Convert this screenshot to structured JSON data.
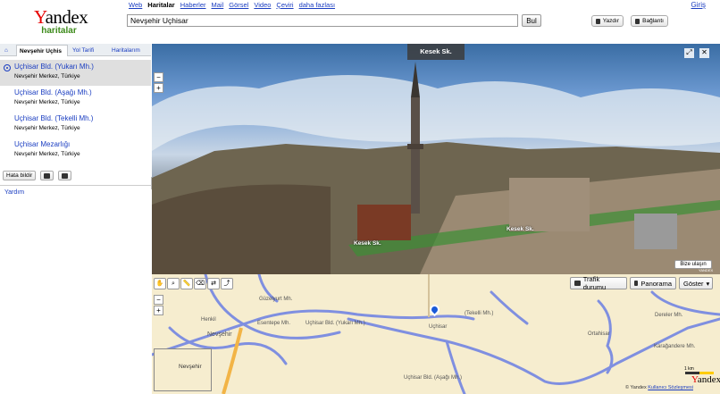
{
  "header": {
    "logo_text_first": "Y",
    "logo_text_rest": "andex",
    "logo_sub": "haritalar",
    "services": [
      "Web",
      "Haritalar",
      "Haberler",
      "Mail",
      "Görsel",
      "Video",
      "Çeviri",
      "daha fazlası"
    ],
    "active_service": "Haritalar",
    "login_label": "Giriş",
    "search_value": "Nevşehir Uçhisar",
    "search_button": "Bul",
    "print_label": "Yazdır",
    "link_label": "Bağlantı"
  },
  "sidebar": {
    "tabs": {
      "search": "Nevşehir Uçhis",
      "route": "Yol Tarifi",
      "maps": "Haritalarım"
    },
    "results": [
      {
        "title": "Uçhisar Bld. (Yukarı Mh.)",
        "address": "Nevşehir Merkez, Türkiye"
      },
      {
        "title": "Uçhisar Bld. (Aşağı Mh.)",
        "address": "Nevşehir Merkez, Türkiye"
      },
      {
        "title": "Uçhisar Bld. (Tekelli Mh.)",
        "address": "Nevşehir Merkez, Türkiye"
      },
      {
        "title": "Uçhisar Mezarlığı",
        "address": "Nevşehir Merkez, Türkiye"
      }
    ],
    "report_error": "Hata bildir",
    "help": "Yardım"
  },
  "panorama": {
    "street_label": "Kesek Sk.",
    "street_tag_1": "Kesek Sk.",
    "street_tag_2": "Kesek Sk.",
    "report_button": "Bize ulaşın",
    "brand": "YANDEX"
  },
  "map": {
    "traffic_label": "Trafik durumu",
    "panorama_label": "Panorama",
    "show_label": "Göster",
    "labels": {
      "guzelyurt": "Güzelyurt Mh.",
      "esentepe": "Esentepe Mh.",
      "nevsehir_big": "Nevşehir",
      "nevsehir_small": "Nevşehir",
      "henkil": "Henkil",
      "uchisar_yukari": "Uçhisar Bld. (Yukarı Mh.)",
      "tekelli": "(Tekelli Mh.)",
      "uchisar": "Uçhisar",
      "asagi": "Uçhisar Bld. (Aşağı Mh.)",
      "dereler": "Dereler Mh.",
      "karagandere": "Karağandere Mh.",
      "ortahisar": "Ortahisar"
    },
    "overview_label": "Nevşehir",
    "scale_label": "1 km",
    "logo_first": "Y",
    "logo_rest": "andex",
    "copyright": "© Yandex",
    "terms": "Kullanıcı Sözleşmesi"
  },
  "colors": {
    "link": "#1a3dc1",
    "road": "#7f8fe0",
    "map_bg": "#f6edcf",
    "logo_red": "#e60000",
    "sub_green": "#3c8a1a"
  }
}
